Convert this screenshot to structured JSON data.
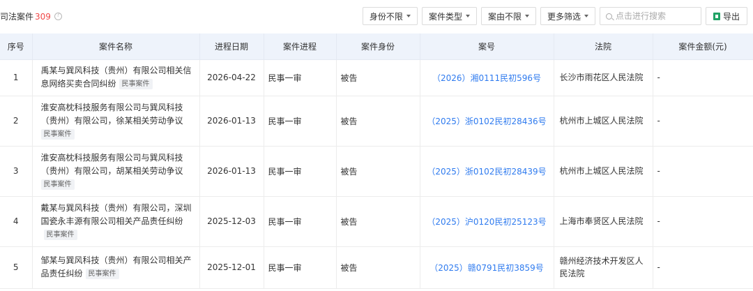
{
  "header": {
    "title": "司法案件",
    "count": "309",
    "filters": [
      "身份不限",
      "案件类型",
      "案由不限",
      "更多筛选"
    ],
    "search_placeholder": "点击进行搜索",
    "export_label": "导出"
  },
  "table": {
    "columns": [
      "序号",
      "案件名称",
      "进程日期",
      "案件进程",
      "案件身份",
      "案号",
      "法院",
      "案件金额(元)"
    ],
    "rows": [
      {
        "index": "1",
        "name": "禹某与巽风科技（贵州）有限公司相关信息网络买卖合同纠纷",
        "tag": "民事案件",
        "date": "2026-04-22",
        "stage": "民事一审",
        "role": "被告",
        "case_no": "（2026）湘0111民初596号",
        "court": "长沙市雨花区人民法院",
        "amount": "-"
      },
      {
        "index": "2",
        "name": "淮安高枕科技服务有限公司与巽风科技（贵州）有限公司，徐某相关劳动争议",
        "tag": "民事案件",
        "date": "2026-01-13",
        "stage": "民事一审",
        "role": "被告",
        "case_no": "（2025）浙0102民初28436号",
        "court": "杭州市上城区人民法院",
        "amount": "-"
      },
      {
        "index": "3",
        "name": "淮安高枕科技服务有限公司与巽风科技（贵州）有限公司，胡某相关劳动争议",
        "tag": "民事案件",
        "date": "2026-01-13",
        "stage": "民事一审",
        "role": "被告",
        "case_no": "（2025）浙0102民初28439号",
        "court": "杭州市上城区人民法院",
        "amount": "-"
      },
      {
        "index": "4",
        "name": "戴某与巽风科技（贵州）有限公司，深圳国瓷永丰源有限公司相关产品责任纠纷",
        "tag": "民事案件",
        "date": "2025-12-03",
        "stage": "民事一审",
        "role": "被告",
        "case_no": "（2025）沪0120民初25123号",
        "court": "上海市奉贤区人民法院",
        "amount": "-"
      },
      {
        "index": "5",
        "name": "邹某与巽风科技（贵州）有限公司相关产品责任纠纷",
        "tag": "民事案件",
        "date": "2025-12-01",
        "stage": "民事一审",
        "role": "被告",
        "case_no": "（2025）赣0791民初3859号",
        "court": "赣州经济技术开发区人民法院",
        "amount": "-"
      }
    ]
  }
}
